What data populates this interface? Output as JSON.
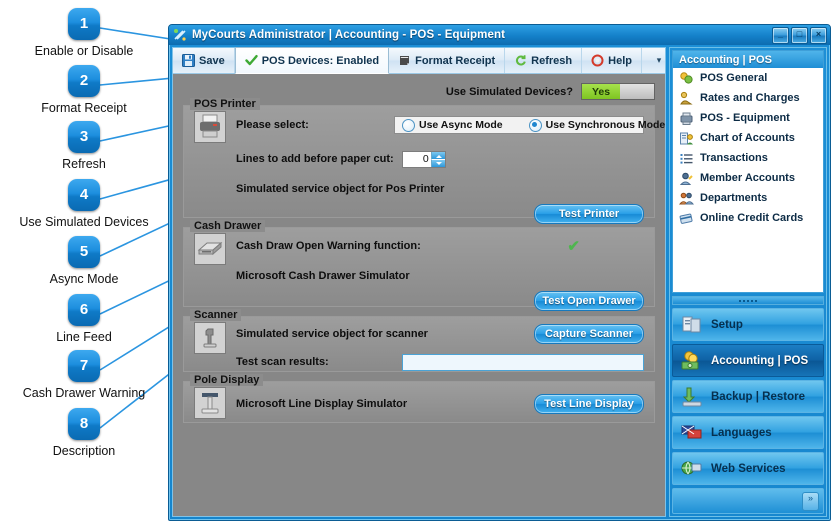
{
  "callouts": [
    {
      "num": "1",
      "label": "Enable or Disable"
    },
    {
      "num": "2",
      "label": "Format Receipt"
    },
    {
      "num": "3",
      "label": "Refresh"
    },
    {
      "num": "4",
      "label": "Use Simulated Devices"
    },
    {
      "num": "5",
      "label": "Async Mode"
    },
    {
      "num": "6",
      "label": "Line Feed"
    },
    {
      "num": "7",
      "label": "Cash Drawer Warning"
    },
    {
      "num": "8",
      "label": "Description"
    }
  ],
  "window": {
    "title": "MyCourts Administrator | Accounting - POS - Equipment",
    "minimize": "_",
    "maximize": "□",
    "close": "×"
  },
  "toolbar": {
    "items": [
      {
        "label": "Save",
        "icon": "save-icon"
      },
      {
        "label": "POS Devices: Enabled",
        "icon": "green-check-icon"
      },
      {
        "label": "Format Receipt",
        "icon": "receipt-icon"
      },
      {
        "label": "Refresh",
        "icon": "refresh-icon"
      },
      {
        "label": "Help",
        "icon": "help-icon"
      }
    ],
    "overflow": "▾"
  },
  "simulated": {
    "label": "Use Simulated Devices?",
    "value": "Yes"
  },
  "pos_printer": {
    "legend": "POS Printer",
    "icon": "printer-icon",
    "please_select": "Please select:",
    "option_async": "Use Async Mode",
    "option_sync": "Use Synchronous Mode",
    "selected": "Use Synchronous Mode",
    "lines_label": "Lines to add before paper cut:",
    "lines_value": "0",
    "service_object": "Simulated service object for Pos Printer",
    "test_button": "Test Printer"
  },
  "cash_drawer": {
    "legend": "Cash Drawer",
    "icon": "cash-drawer-icon",
    "warning_label": "Cash Draw Open Warning function:",
    "warning_state": "✔",
    "service_object": "Microsoft Cash Drawer Simulator",
    "test_button": "Test Open Drawer"
  },
  "scanner": {
    "legend": "Scanner",
    "icon": "scanner-icon",
    "service_object": "Simulated service object for scanner",
    "capture_button": "Capture Scanner",
    "results_label": "Test scan results:",
    "results_value": ""
  },
  "pole_display": {
    "legend": "Pole Display",
    "icon": "pole-display-icon",
    "service_object": "Microsoft Line Display Simulator",
    "test_button": "Test Line Display"
  },
  "nav": {
    "header": "Accounting | POS",
    "items": [
      {
        "label": "POS General",
        "icon": "pos-general-icon"
      },
      {
        "label": "Rates and Charges",
        "icon": "rates-charges-icon"
      },
      {
        "label": "POS - Equipment",
        "icon": "pos-equipment-icon"
      },
      {
        "label": "Chart of Accounts",
        "icon": "chart-accounts-icon"
      },
      {
        "label": "Transactions",
        "icon": "transactions-icon"
      },
      {
        "label": "Member Accounts",
        "icon": "member-accounts-icon"
      },
      {
        "label": "Departments",
        "icon": "departments-icon"
      },
      {
        "label": "Online Credit Cards",
        "icon": "online-credit-cards-icon"
      }
    ],
    "modules": [
      {
        "label": "Setup",
        "icon": "setup-icon",
        "selected": false
      },
      {
        "label": "Accounting | POS",
        "icon": "accounting-pos-icon",
        "selected": true
      },
      {
        "label": "Backup | Restore",
        "icon": "backup-restore-icon",
        "selected": false
      },
      {
        "label": "Languages",
        "icon": "languages-icon",
        "selected": false
      },
      {
        "label": "Web Services",
        "icon": "web-services-icon",
        "selected": false
      }
    ],
    "expand": "»"
  },
  "colors": {
    "accent_blue": "#1d8fd6",
    "callout_blue": "#1d8ede",
    "toggle_green": "#8ece31",
    "button_blue": "#2aa0e8",
    "content_grey": "#878787"
  }
}
